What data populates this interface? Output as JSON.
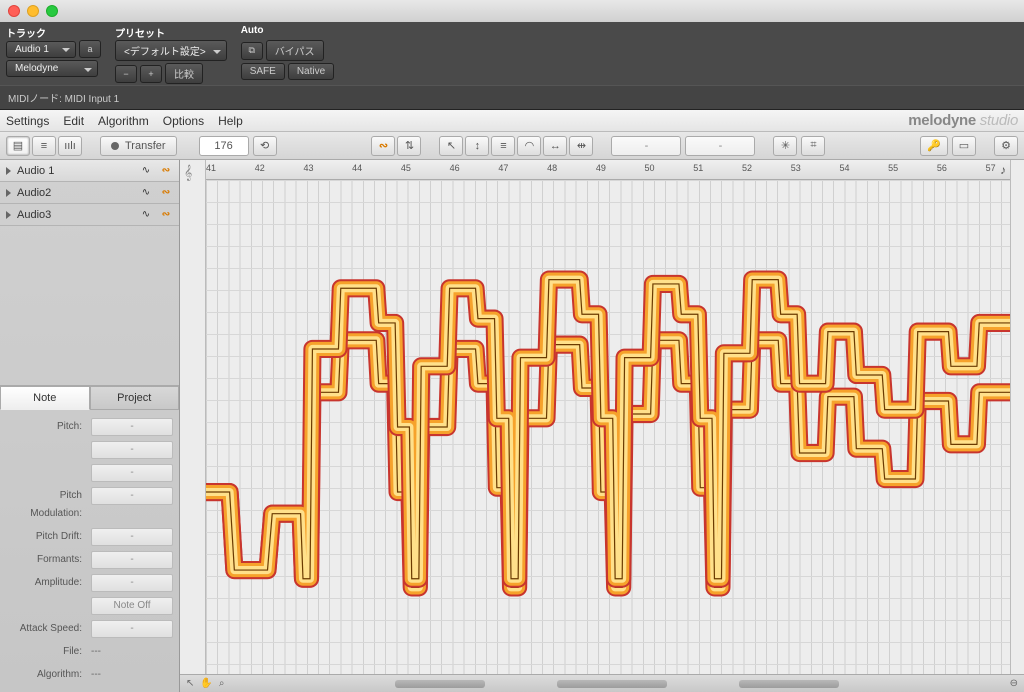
{
  "window": {
    "title": ""
  },
  "host": {
    "track_label": "トラック",
    "preset_label": "プリセット",
    "auto_label": "Auto",
    "track_sel": "Audio 1",
    "track_letter": "a",
    "instrument": "Melodyne",
    "preset_sel": "<デフォルト設定>",
    "compare": "比較",
    "safe": "SAFE",
    "bypass": "バイパス",
    "native": "Native"
  },
  "midi_bar": "MIDIノード: MIDI Input 1",
  "menu": {
    "items": [
      "Settings",
      "Edit",
      "Algorithm",
      "Options",
      "Help"
    ],
    "brand": "melodyne",
    "brand_sub": "studio"
  },
  "toolbar": {
    "transfer": "Transfer",
    "tempo": "176",
    "field1": "-",
    "field2": "-"
  },
  "tracks": [
    {
      "name": "Audio 1"
    },
    {
      "name": "Audio2"
    },
    {
      "name": "Audio3"
    }
  ],
  "inspector": {
    "tab_note": "Note",
    "tab_project": "Project",
    "rows": {
      "pitch": {
        "label": "Pitch:",
        "val": "-"
      },
      "pitch2": {
        "label": "",
        "val": "-"
      },
      "pitch3": {
        "label": "",
        "val": "-"
      },
      "pitch_mod": {
        "label": "Pitch Modulation:",
        "val": "-"
      },
      "pitch_drift": {
        "label": "Pitch Drift:",
        "val": "-"
      },
      "formants": {
        "label": "Formants:",
        "val": "-"
      },
      "amplitude": {
        "label": "Amplitude:",
        "val": "-"
      },
      "noteoff": {
        "label": "",
        "val": "Note Off"
      },
      "attack": {
        "label": "Attack Speed:",
        "val": "-"
      },
      "file": {
        "label": "File:",
        "val": "---"
      },
      "algorithm": {
        "label": "Algorithm:",
        "val": "---"
      }
    }
  },
  "ruler": {
    "start": 41,
    "end": 57
  }
}
